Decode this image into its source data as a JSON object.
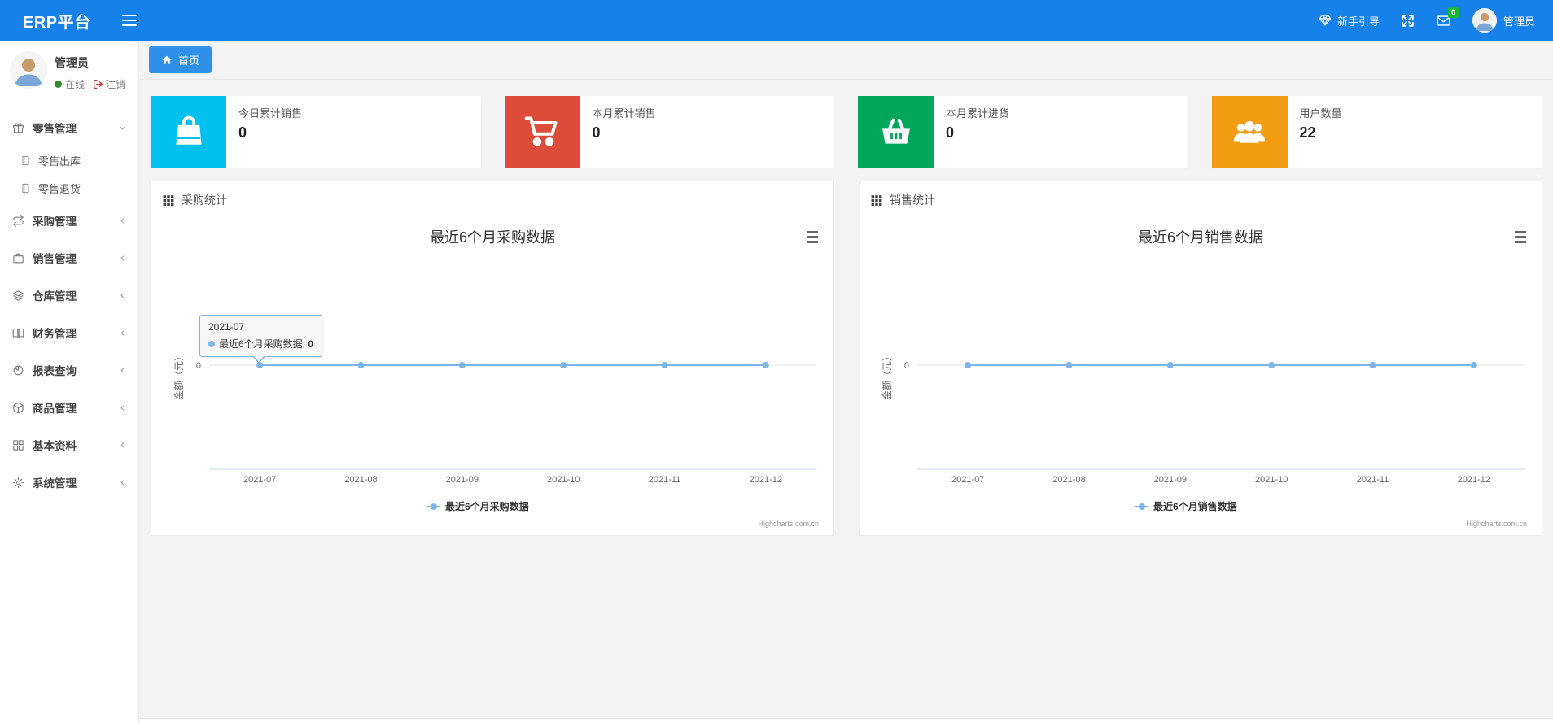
{
  "colors": {
    "navbar": "#1681e8",
    "tab": "#2e90e8",
    "badge": "#14b434",
    "series": "#7cb5ec"
  },
  "navbar": {
    "brand": "ERP平台",
    "guide_label": "新手引导",
    "mail_badge": "0",
    "user_name": "管理员"
  },
  "sidebar": {
    "profile": {
      "name": "管理员",
      "status": "在线",
      "logout": "注销"
    },
    "menu": [
      {
        "label": "零售管理",
        "icon": "gift-icon",
        "expanded": true,
        "children": [
          {
            "label": "零售出库",
            "icon": "book-icon"
          },
          {
            "label": "零售退货",
            "icon": "book-icon"
          }
        ]
      },
      {
        "label": "采购管理",
        "icon": "repeat-icon"
      },
      {
        "label": "销售管理",
        "icon": "briefcase-icon"
      },
      {
        "label": "仓库管理",
        "icon": "layers-icon"
      },
      {
        "label": "财务管理",
        "icon": "book-open-icon"
      },
      {
        "label": "报表查询",
        "icon": "pie-chart-icon"
      },
      {
        "label": "商品管理",
        "icon": "box-icon"
      },
      {
        "label": "基本资料",
        "icon": "grid-icon"
      },
      {
        "label": "系统管理",
        "icon": "gear-icon"
      }
    ]
  },
  "tabs": {
    "home": "首页"
  },
  "cards": [
    {
      "title": "今日累计销售",
      "value": "0",
      "color": "#00c0ef",
      "icon": "shopping-bag-icon"
    },
    {
      "title": "本月累计销售",
      "value": "0",
      "color": "#dd4b39",
      "icon": "shopping-cart-icon"
    },
    {
      "title": "本月累计进货",
      "value": "0",
      "color": "#00a65a",
      "icon": "basket-icon"
    },
    {
      "title": "用户数量",
      "value": "22",
      "color": "#f39c12",
      "icon": "users-icon"
    }
  ],
  "panels": [
    {
      "title": "采购统计"
    },
    {
      "title": "销售统计"
    }
  ],
  "chart_data": [
    {
      "type": "line",
      "title": "最近6个月采购数据",
      "categories": [
        "2021-07",
        "2021-08",
        "2021-09",
        "2021-10",
        "2021-11",
        "2021-12"
      ],
      "series": [
        {
          "name": "最近6个月采购数据",
          "values": [
            0,
            0,
            0,
            0,
            0,
            0
          ]
        }
      ],
      "xlabel": "",
      "ylabel": "金额（元）",
      "yticks": [
        "0"
      ],
      "color": "#7cb5ec",
      "grid": true,
      "legend_position": "bottom",
      "credits": "Highcharts.com.cn",
      "tooltip": {
        "header": "2021-07",
        "series": "最近6个月采购数据",
        "value": "0",
        "point_index": 0
      }
    },
    {
      "type": "line",
      "title": "最近6个月销售数据",
      "categories": [
        "2021-07",
        "2021-08",
        "2021-09",
        "2021-10",
        "2021-11",
        "2021-12"
      ],
      "series": [
        {
          "name": "最近6个月销售数据",
          "values": [
            0,
            0,
            0,
            0,
            0,
            0
          ]
        }
      ],
      "xlabel": "",
      "ylabel": "金额（元）",
      "yticks": [
        "0"
      ],
      "color": "#7cb5ec",
      "grid": true,
      "legend_position": "bottom",
      "credits": "Highcharts.com.cn"
    }
  ]
}
